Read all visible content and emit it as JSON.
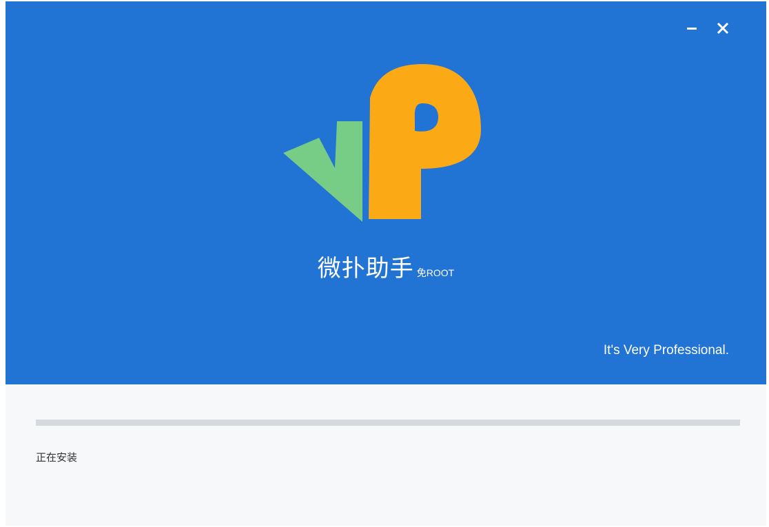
{
  "window": {
    "controls": {
      "minimize_icon": "minimize-icon",
      "close_icon": "close-icon"
    }
  },
  "hero": {
    "background_color": "#2174d3",
    "logo": {
      "green_color": "#78cd86",
      "orange_color": "#fbaa15"
    },
    "title": "微扑助手",
    "subtitle": "免ROOT",
    "slogan": "It's Very Professional."
  },
  "footer": {
    "progress": 0,
    "status_text": "正在安装"
  }
}
